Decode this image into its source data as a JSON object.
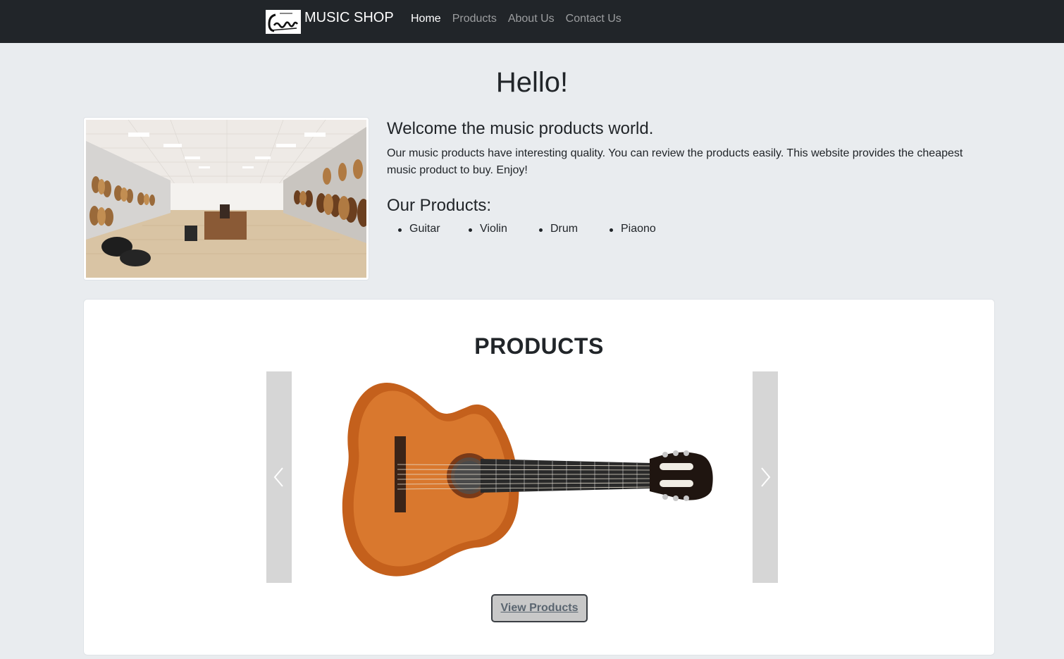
{
  "navbar": {
    "brand_name": "MUSIC SHOP",
    "logo_icon": "guitar-logo-icon",
    "links": [
      {
        "label": "Home",
        "active": true
      },
      {
        "label": "Products",
        "active": false
      },
      {
        "label": "About Us",
        "active": false
      },
      {
        "label": "Contact Us",
        "active": false
      }
    ]
  },
  "hero": {
    "title": "Hello!",
    "image_icon": "music-store-photo",
    "welcome": "Welcome the music products world.",
    "intro": "Our music products have interesting quality. You can review the products easily. This website provides the cheapest music product to buy. Enjoy!",
    "products_heading": "Our Products:",
    "products": [
      "Guitar",
      "Violin",
      "Drum",
      "Piaono"
    ]
  },
  "products_section": {
    "title": "PRODUCTS",
    "slide_image": "classical-guitar-image",
    "prev_icon": "chevron-left-icon",
    "next_icon": "chevron-right-icon",
    "button_label": "View Products"
  },
  "colors": {
    "navbar_bg": "#212529",
    "page_bg": "#e9ecef",
    "card_bg": "#ffffff",
    "control_bg": "#d6d6d6",
    "button_bg": "#c8c8c8"
  }
}
